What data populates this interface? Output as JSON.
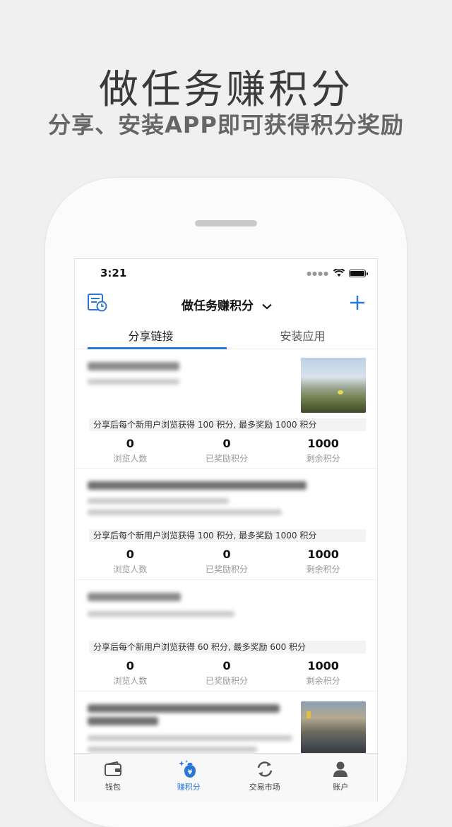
{
  "promo": {
    "title": "做任务赚积分",
    "subtitle": "分享、安装APP即可获得积分奖励"
  },
  "status_bar": {
    "time": "3:21"
  },
  "nav": {
    "title": "做任务赚积分"
  },
  "tabs": [
    {
      "label": "分享链接",
      "active": true
    },
    {
      "label": "安装应用",
      "active": false
    }
  ],
  "tasks": [
    {
      "desc": "分享后每个新用户浏览获得 100 积分, 最多奖励 1000 积分",
      "views": "0",
      "views_label": "浏览人数",
      "rewarded": "0",
      "rewarded_label": "已奖励积分",
      "remaining": "1000",
      "remaining_label": "剩余积分"
    },
    {
      "desc": "分享后每个新用户浏览获得 100 积分, 最多奖励 1000 积分",
      "views": "0",
      "views_label": "浏览人数",
      "rewarded": "0",
      "rewarded_label": "已奖励积分",
      "remaining": "1000",
      "remaining_label": "剩余积分"
    },
    {
      "desc": "分享后每个新用户浏览获得 60 积分, 最多奖励 600 积分",
      "views": "0",
      "views_label": "浏览人数",
      "rewarded": "0",
      "rewarded_label": "已奖励积分",
      "remaining": "1000",
      "remaining_label": "剩余积分"
    }
  ],
  "tabbar": [
    {
      "label": "钱包",
      "icon": "wallet-icon",
      "active": false
    },
    {
      "label": "赚积分",
      "icon": "earn-points-icon",
      "active": true
    },
    {
      "label": "交易市场",
      "icon": "exchange-icon",
      "active": false
    },
    {
      "label": "账户",
      "icon": "account-icon",
      "active": false
    }
  ],
  "colors": {
    "accent": "#2b77d8",
    "background": "#f0f0f0"
  }
}
